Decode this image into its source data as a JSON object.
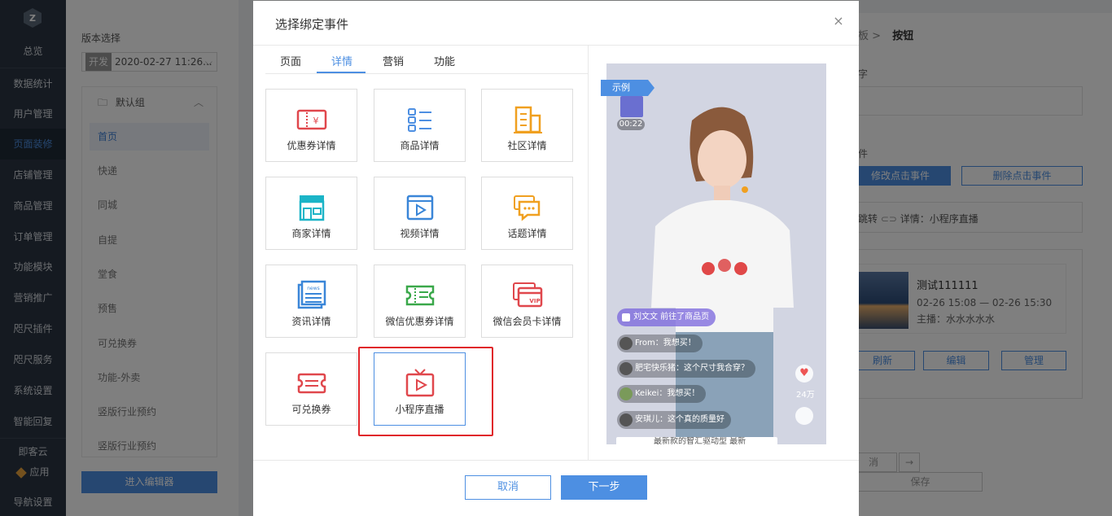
{
  "nav": {
    "items": [
      "总览",
      "数据统计",
      "用户管理",
      "页面装修",
      "店铺管理",
      "商品管理",
      "订单管理",
      "功能模块",
      "营销推广",
      "咫尺插件",
      "咫尺服务",
      "系统设置",
      "智能回复",
      "即客云",
      "应用",
      "导航设置"
    ],
    "active": "页面装修"
  },
  "sidebar": {
    "version_label": "版本选择",
    "version_tag": "开发",
    "version_value": "2020-02-27 11:26...",
    "group_name": "默认组",
    "pages": [
      "首页",
      "快递",
      "同城",
      "自提",
      "堂食",
      "预售",
      "可兑换券",
      "功能-外卖",
      "竖版行业预约",
      "竖版行业预约"
    ],
    "active_page": "首页",
    "enter_editor": "进入编辑器"
  },
  "right_panel": {
    "crumb_prev": "板",
    "crumb_current": "按钮",
    "label_text": "字",
    "label_event": "件",
    "modify_event": "修改点击事件",
    "delete_event": "删除点击事件",
    "jump_label": "跳转",
    "jump_value": "详情：小程序直播",
    "live_title": "测试111111",
    "live_time": "02-26 15:08 — 02-26 15:30",
    "live_host": "主播：水水水水水",
    "btn_refresh": "刷新",
    "btn_edit": "编辑",
    "btn_manage": "管理",
    "btn_cancel": "消",
    "btn_save": "保存"
  },
  "modal": {
    "title": "选择绑定事件",
    "close": "×",
    "tabs": [
      "页面",
      "详情",
      "营销",
      "功能"
    ],
    "active_tab": "详情",
    "cards": [
      {
        "label": "优惠券详情",
        "icon": "coupon-icon"
      },
      {
        "label": "商品详情",
        "icon": "product-list-icon"
      },
      {
        "label": "社区详情",
        "icon": "building-icon"
      },
      {
        "label": "商家详情",
        "icon": "store-icon"
      },
      {
        "label": "视频详情",
        "icon": "video-icon"
      },
      {
        "label": "话题详情",
        "icon": "chat-icon"
      },
      {
        "label": "资讯详情",
        "icon": "news-icon"
      },
      {
        "label": "微信优惠券详情",
        "icon": "wechat-coupon-icon"
      },
      {
        "label": "微信会员卡详情",
        "icon": "vip-card-icon"
      },
      {
        "label": "可兑换券",
        "icon": "voucher-icon"
      },
      {
        "label": "小程序直播",
        "icon": "live-tv-icon"
      }
    ],
    "selected_card": "小程序直播",
    "preview": {
      "tag": "示例",
      "timer": "00:22",
      "messages": [
        {
          "text": "刘文文 前往了商品页"
        },
        {
          "text": "From：我想买！"
        },
        {
          "text": "肥宅快乐猪：这个尺寸我合穿？"
        },
        {
          "text": "Keikei：我想买！"
        },
        {
          "text": "安琪儿：这个真的质量好"
        }
      ],
      "likes": "24万",
      "bottom_text": "最新款的智汇驱动型 最新"
    },
    "cancel": "取消",
    "next": "下一步"
  },
  "colors": {
    "accent": "#4d8fe2",
    "highlight": "#e0262a",
    "nav_bg": "#2b3542"
  }
}
